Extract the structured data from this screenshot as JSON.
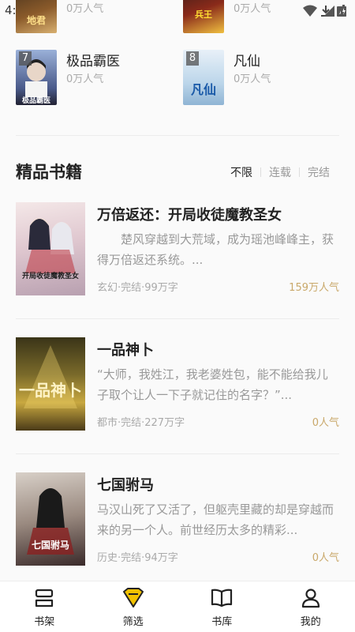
{
  "status_bar": {
    "time": "4:"
  },
  "rank_top": [
    {
      "title": "",
      "popularity": "0万人气"
    },
    {
      "title": "",
      "popularity": "0万人气"
    }
  ],
  "rank": [
    {
      "num": "7",
      "title": "极品霸医",
      "popularity": "0万人气",
      "cover_text": "极品霸医"
    },
    {
      "num": "8",
      "title": "凡仙",
      "popularity": "0万人气",
      "cover_text": "凡仙"
    }
  ],
  "section": {
    "title": "精品书籍",
    "filters": [
      "不限",
      "连载",
      "完结"
    ]
  },
  "books": [
    {
      "title": "万倍返还：开局收徒魔教圣女",
      "desc": "　　楚风穿越到大荒域，成为瑶池峰峰主，获得万倍返还系统。...",
      "meta": "玄幻·完结·99万字",
      "popularity": "159万人气",
      "cover_text": "开局收徒魔教圣女"
    },
    {
      "title": "一品神卜",
      "desc": "“大师，我姓江，我老婆姓包，能不能给我儿子取个让人一下子就记住的名字？”...",
      "meta": "都市·完结·227万字",
      "popularity": "0人气",
      "cover_text": "一品神卜"
    },
    {
      "title": "七国驸马",
      "desc": "马汉山死了又活了，但躯壳里藏的却是穿越而来的另一个人。前世经历太多的精彩...",
      "meta": "历史·完结·94万字",
      "popularity": "0人气",
      "cover_text": "七国驸马"
    }
  ],
  "nav": [
    {
      "label": "书架",
      "icon": "bookshelf-icon"
    },
    {
      "label": "筛选",
      "icon": "filter-icon"
    },
    {
      "label": "书库",
      "icon": "library-icon"
    },
    {
      "label": "我的",
      "icon": "profile-icon"
    }
  ],
  "colors": {
    "accent": "#c9a86a",
    "filter_icon": "#f2c200"
  }
}
